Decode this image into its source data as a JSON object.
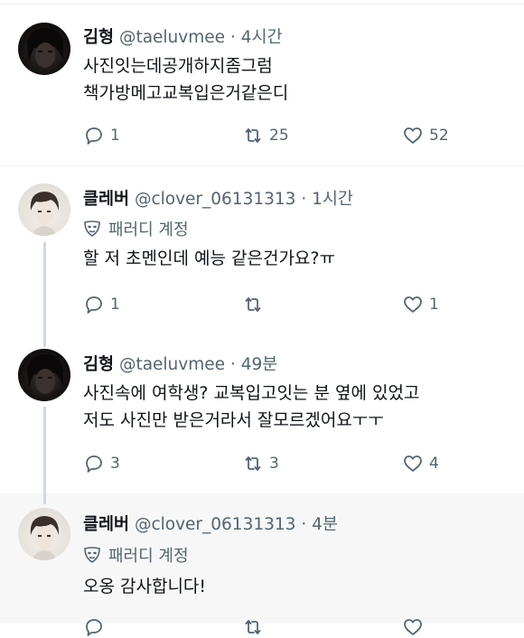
{
  "tweets": [
    {
      "name": "김형",
      "handle": "@taeluvmee",
      "dot": "·",
      "time": "4시간",
      "lines": [
        "사진잇는데공개하지좀그럼",
        "책가방메고교복입은거같은디"
      ],
      "replies": "1",
      "retweets": "25",
      "likes": "52"
    },
    {
      "name": "클레버",
      "handle": "@clover_06131313",
      "dot": "·",
      "time": "1시간",
      "parody": "패러디 계정",
      "lines": [
        "할 저 초멘인데 예능 같은건가요?ㅠ"
      ],
      "replies": "1",
      "retweets": "",
      "likes": "1"
    },
    {
      "name": "김형",
      "handle": "@taeluvmee",
      "dot": "·",
      "time": "49분",
      "lines": [
        "사진속에 여학생? 교복입고잇는 분 옆에 있었고",
        "저도 사진만 받은거라서 잘모르겠어요ㅜㅜ"
      ],
      "replies": "3",
      "retweets": "3",
      "likes": "4"
    },
    {
      "name": "클레버",
      "handle": "@clover_06131313",
      "dot": "·",
      "time": "4분",
      "parody": "패러디 계정",
      "lines": [
        "오옹 감사합니다!"
      ]
    }
  ],
  "icons": {
    "reply": "reply-icon",
    "retweet": "retweet-icon",
    "like": "heart-icon",
    "parody": "mask-icon"
  },
  "colors": {
    "text": "#0f1419",
    "secondary": "#536471",
    "thread_line": "#cfd9de",
    "highlight_bg": "#f7f7f7"
  }
}
